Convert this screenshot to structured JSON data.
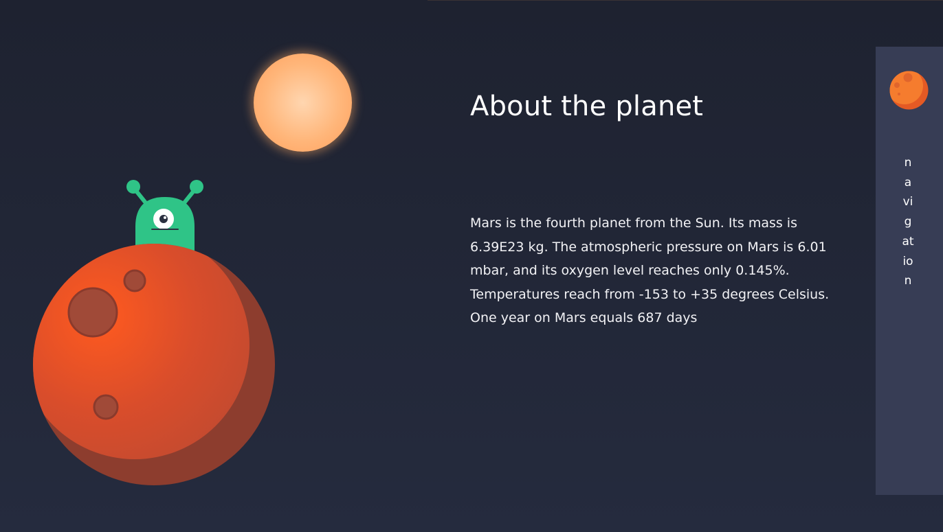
{
  "colors": {
    "background": "#1e2230",
    "nav_panel": "#373d55",
    "sun": "#ffb67a",
    "planet": "#e2542a",
    "alien": "#2fc487"
  },
  "scene": {
    "sun_icon": "sun-circle",
    "planet_icon": "mars-planet",
    "alien_icon": "one-eyed-alien"
  },
  "main": {
    "title": "About the planet",
    "description": "Mars is the fourth planet from the Sun. Its mass is 6.39E23 kg. The atmospheric pressure on Mars is 6.01 mbar, and its oxygen level reaches only 0.145%. Temperatures reach from -153 to +35 degrees Celsius. One year on Mars equals 687 days"
  },
  "nav": {
    "logo_icon": "mars-logo-icon",
    "label": "navigation"
  }
}
